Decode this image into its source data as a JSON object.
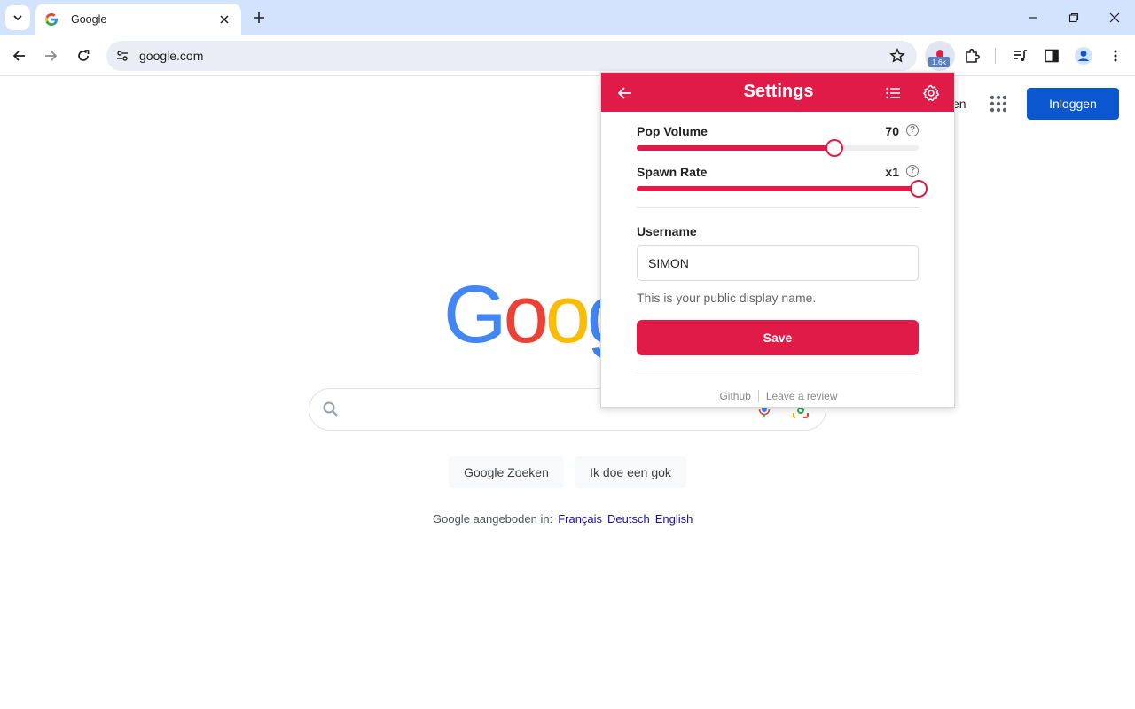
{
  "browser": {
    "tab_title": "Google",
    "url": "google.com",
    "extension_badge": "1.6k"
  },
  "google": {
    "signin_label": "Inloggen",
    "partial_link": "en",
    "logo_letters": [
      "G",
      "o",
      "o",
      "g"
    ],
    "logo_colors": [
      "#4285f4",
      "#ea4335",
      "#fbbc05",
      "#4285f4"
    ],
    "search_button": "Google Zoeken",
    "lucky_button": "Ik doe een gok",
    "offered_in": "Google aangeboden in:",
    "languages": [
      "Français",
      "Deutsch",
      "English"
    ]
  },
  "popup": {
    "title": "Settings",
    "accent": "#e01b48",
    "pop_volume": {
      "label": "Pop Volume",
      "value_text": "70",
      "fraction": 0.7
    },
    "spawn_rate": {
      "label": "Spawn Rate",
      "value_text": "x1",
      "fraction": 1.0
    },
    "username": {
      "label": "Username",
      "value": "SIMON",
      "hint": "This is your public display name."
    },
    "save_label": "Save",
    "footer": {
      "github": "Github",
      "review": "Leave a review"
    }
  }
}
